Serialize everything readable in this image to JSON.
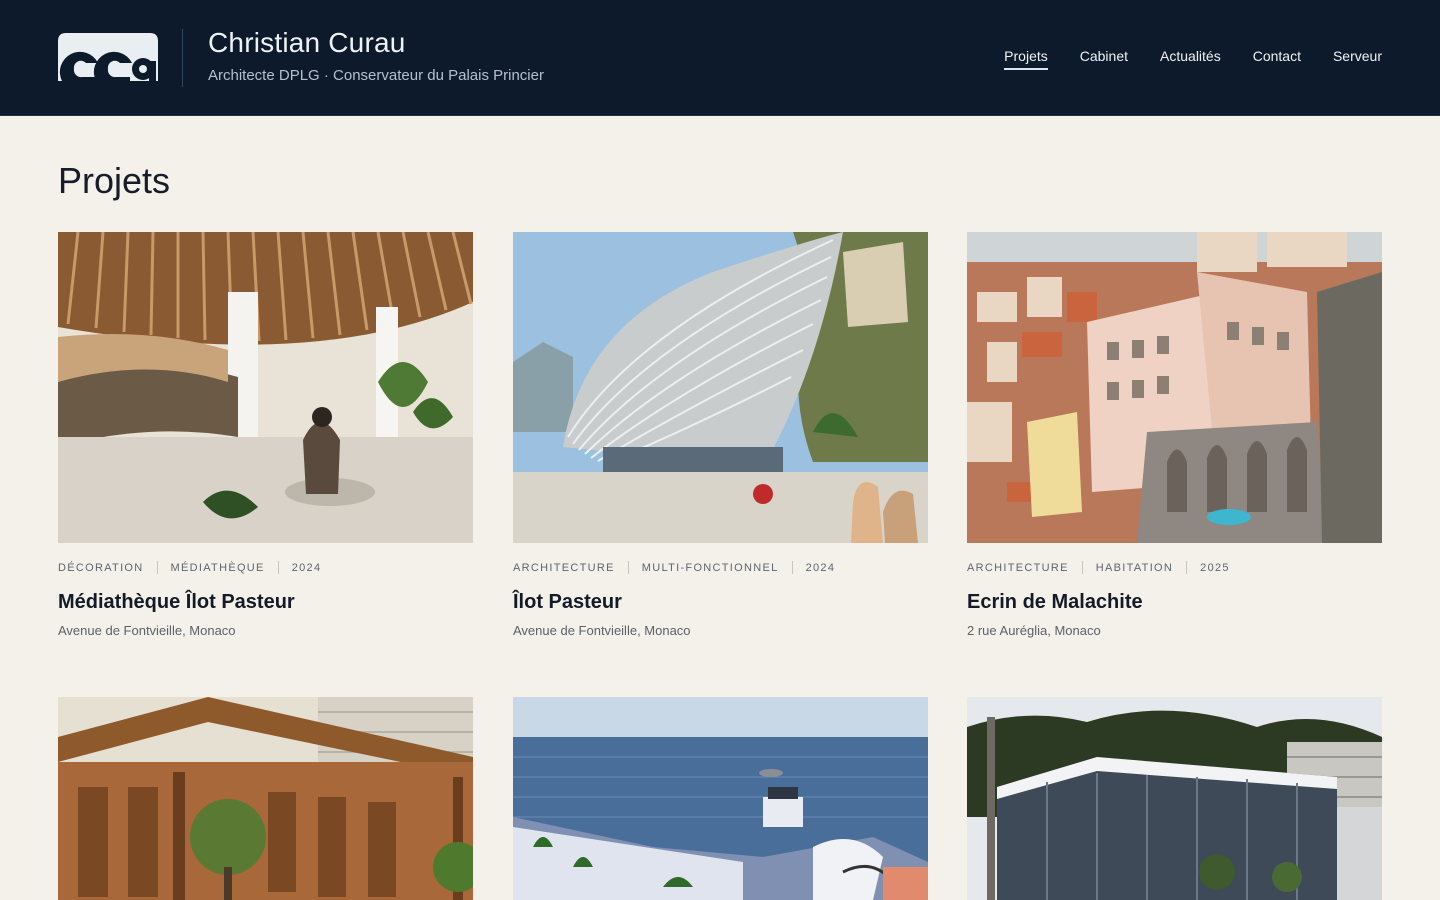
{
  "header": {
    "logo_text": "cca",
    "brand_name": "Christian Curau",
    "tagline": "Architecte DPLG · Conservateur du Palais Princier",
    "nav": [
      {
        "label": "Projets",
        "active": true
      },
      {
        "label": "Cabinet"
      },
      {
        "label": "Actualités"
      },
      {
        "label": "Contact"
      },
      {
        "label": "Serveur"
      }
    ]
  },
  "main": {
    "title": "Projets",
    "projects": [
      {
        "tags": [
          "DÉCORATION",
          "MÉDIATHÈQUE",
          "2024"
        ],
        "title": "Médiathèque Îlot Pasteur",
        "address": "Avenue de Fontvieille, Monaco",
        "image": "interior-library-render"
      },
      {
        "tags": [
          "ARCHITECTURE",
          "MULTI-FONCTIONNEL",
          "2024"
        ],
        "title": "Îlot Pasteur",
        "address": "Avenue de Fontvieille, Monaco",
        "image": "curved-lattice-building-render"
      },
      {
        "tags": [
          "ARCHITECTURE",
          "HABITATION",
          "2025"
        ],
        "title": "Ecrin de Malachite",
        "address": "2 rue Auréglia, Monaco",
        "image": "cliffside-residences-render"
      },
      {
        "image": "wooden-pergola-building-photo"
      },
      {
        "image": "seafront-heliport-render"
      },
      {
        "image": "glass-facade-building-photo"
      }
    ]
  },
  "colors": {
    "header_bg": "#0d1a2b",
    "page_bg": "#f4f1ea",
    "text": "#141b26"
  }
}
